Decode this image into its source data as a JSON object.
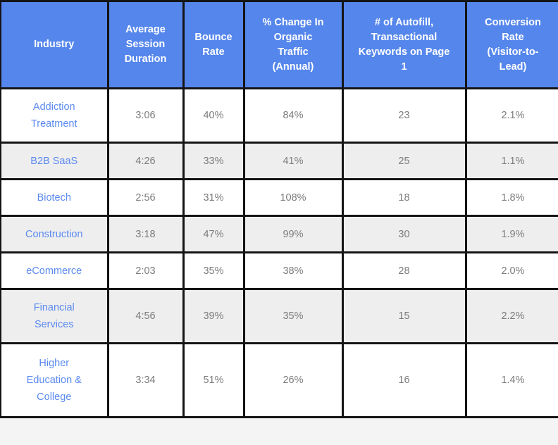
{
  "table": {
    "columns": [
      "Industry",
      "Average Session Duration",
      "Bounce Rate",
      "% Change In Organic Traffic (Annual)",
      "# of Autofill, Transactional Keywords on Page 1",
      "Conversion Rate (Visitor-to-Lead)"
    ],
    "column_lines": [
      [
        "Industry"
      ],
      [
        "Average",
        "Session",
        "Duration"
      ],
      [
        "Bounce",
        "Rate"
      ],
      [
        "% Change In",
        "Organic",
        "Traffic",
        "(Annual)"
      ],
      [
        "# of Autofill,",
        "Transactional",
        "Keywords on Page",
        "1"
      ],
      [
        "Conversion",
        "Rate",
        "(Visitor-to-",
        "Lead)"
      ]
    ],
    "rows": [
      {
        "industry": "Addiction Treatment",
        "industry_lines": [
          "Addiction",
          "Treatment"
        ],
        "avg_session_duration": "3:06",
        "bounce_rate": "40%",
        "organic_traffic_change": "84%",
        "autofill_keywords_page1": "23",
        "conversion_rate": "2.1%",
        "shade": "white",
        "height": "tall"
      },
      {
        "industry": "B2B SaaS",
        "industry_lines": [
          "B2B SaaS"
        ],
        "avg_session_duration": "4:26",
        "bounce_rate": "33%",
        "organic_traffic_change": "41%",
        "autofill_keywords_page1": "25",
        "conversion_rate": "1.1%",
        "shade": "gray",
        "height": "short"
      },
      {
        "industry": "Biotech",
        "industry_lines": [
          "Biotech"
        ],
        "avg_session_duration": "2:56",
        "bounce_rate": "31%",
        "organic_traffic_change": "108%",
        "autofill_keywords_page1": "18",
        "conversion_rate": "1.8%",
        "shade": "white",
        "height": "short"
      },
      {
        "industry": "Construction",
        "industry_lines": [
          "Construction"
        ],
        "avg_session_duration": "3:18",
        "bounce_rate": "47%",
        "organic_traffic_change": "99%",
        "autofill_keywords_page1": "30",
        "conversion_rate": "1.9%",
        "shade": "gray",
        "height": "short"
      },
      {
        "industry": "eCommerce",
        "industry_lines": [
          "eCommerce"
        ],
        "avg_session_duration": "2:03",
        "bounce_rate": "35%",
        "organic_traffic_change": "38%",
        "autofill_keywords_page1": "28",
        "conversion_rate": "2.0%",
        "shade": "white",
        "height": "short"
      },
      {
        "industry": "Financial Services",
        "industry_lines": [
          "Financial",
          "Services"
        ],
        "avg_session_duration": "4:56",
        "bounce_rate": "39%",
        "organic_traffic_change": "35%",
        "autofill_keywords_page1": "15",
        "conversion_rate": "2.2%",
        "shade": "gray",
        "height": "tall"
      },
      {
        "industry": "Higher Education & College",
        "industry_lines": [
          "Higher",
          "Education &",
          "College"
        ],
        "avg_session_duration": "3:34",
        "bounce_rate": "51%",
        "organic_traffic_change": "26%",
        "autofill_keywords_page1": "16",
        "conversion_rate": "1.4%",
        "shade": "white",
        "height": "last"
      }
    ]
  },
  "colors": {
    "header_background": "#5586ec",
    "header_text": "#ffffff",
    "link_text": "#5b8af0",
    "cell_text": "#7c7c7c",
    "row_alt_background": "#eeeeee",
    "row_background": "#ffffff",
    "border": "#141414"
  }
}
